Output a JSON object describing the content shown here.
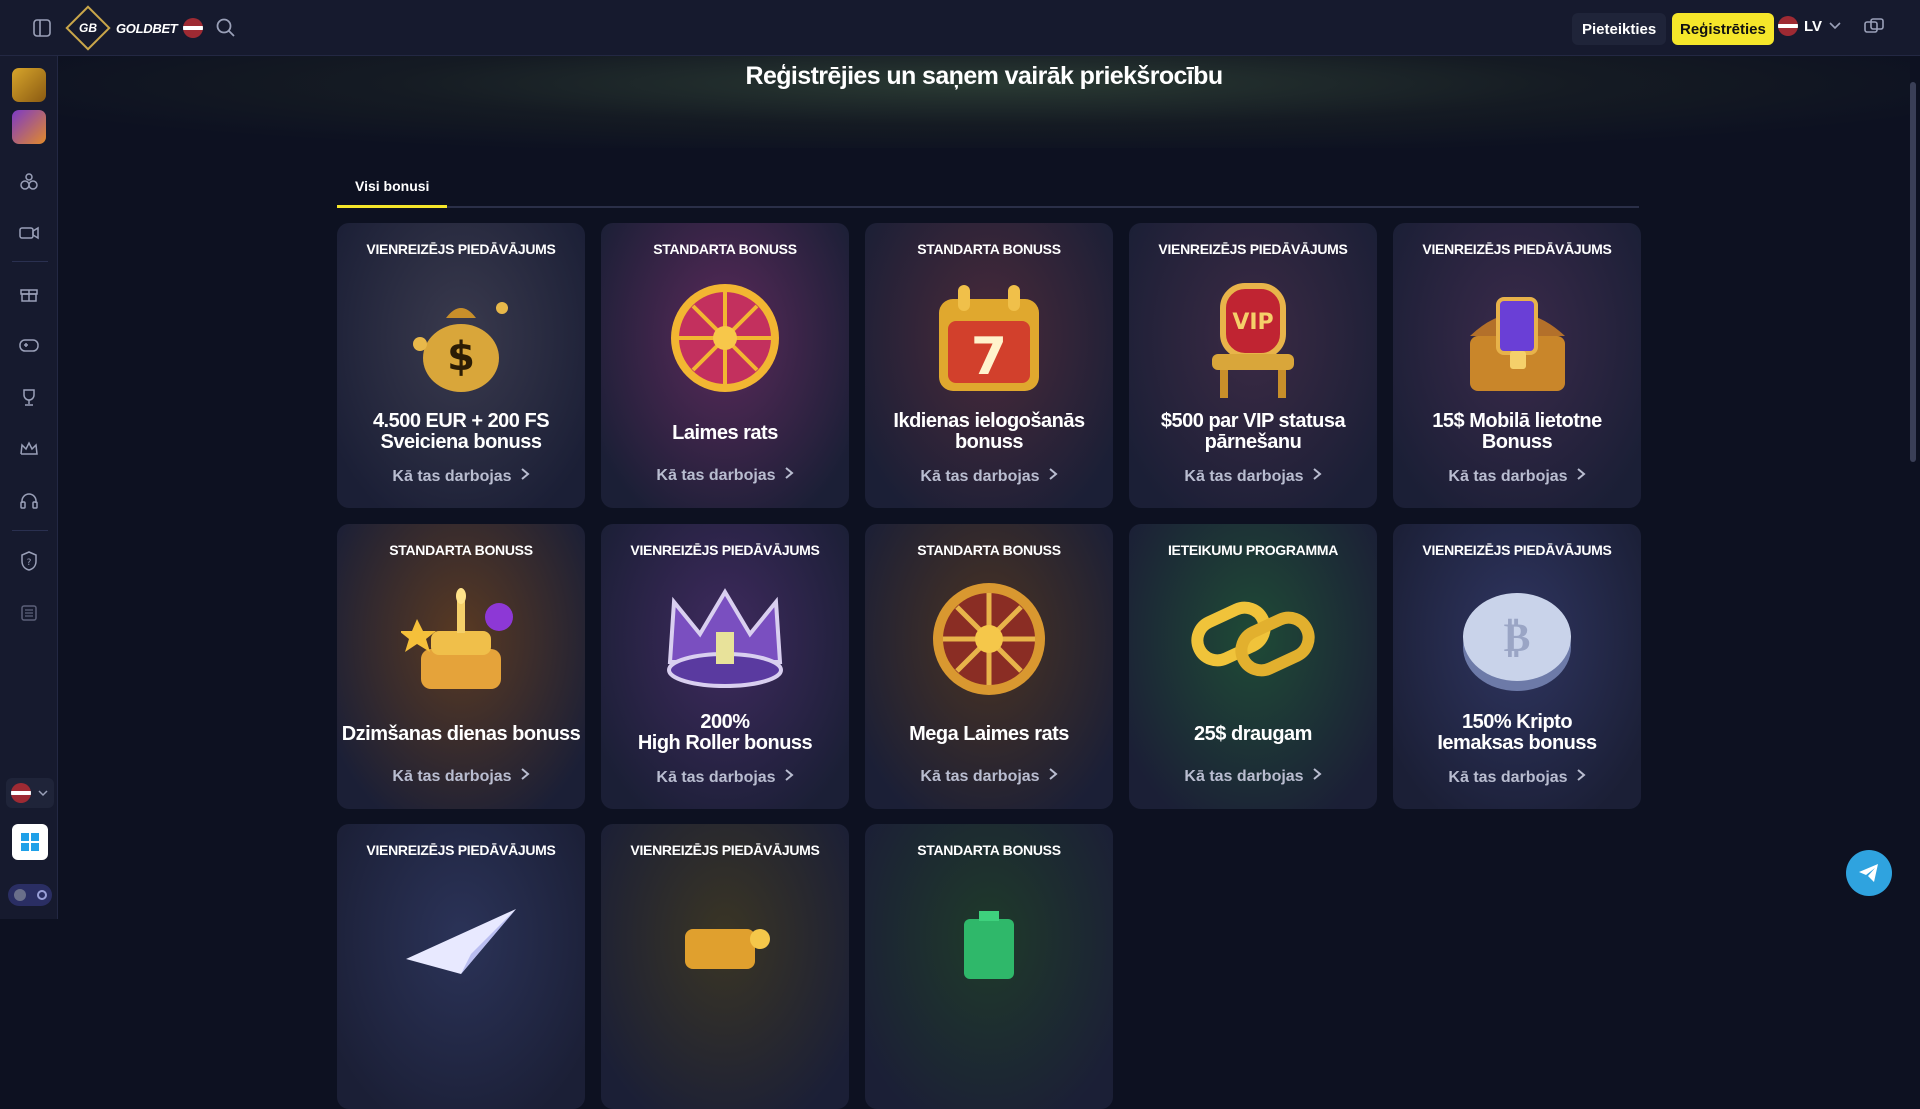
{
  "header": {
    "logo_text": "GOLDBET",
    "logo_mark": "GB",
    "login_label": "Pieteikties",
    "register_label": "Reģistrēties",
    "language_code": "LV"
  },
  "hero": {
    "title": "Reģistrējies un saņem vairāk priekšrocību"
  },
  "tabs": [
    {
      "label": "Visi bonusi",
      "active": true
    }
  ],
  "cards": [
    {
      "label": "VIENREIZĒJS PIEDĀVĀJUMS",
      "title_lines": [
        "4.500 EUR + 200 FS",
        "Sveiciena bonuss"
      ],
      "link": "Kā tas darbojas",
      "art": "money-bag",
      "bg": "#3a3a4d"
    },
    {
      "label": "STANDARTA BONUSS",
      "title_lines": [
        "Laimes rats"
      ],
      "link": "Kā tas darbojas",
      "art": "wheel",
      "bg": "#5a2a5a"
    },
    {
      "label": "STANDARTA BONUSS",
      "title_lines": [
        "Ikdienas ielogošanās",
        "bonuss"
      ],
      "link": "Kā tas darbojas",
      "art": "calendar",
      "bg": "#4a2a3a"
    },
    {
      "label": "VIENREIZĒJS PIEDĀVĀJUMS",
      "title_lines": [
        "$500 par VIP statusa",
        "pārnešanu"
      ],
      "link": "Kā tas darbojas",
      "art": "vip-throne",
      "bg": "#3b2a44"
    },
    {
      "label": "VIENREIZĒJS PIEDĀVĀJUMS",
      "title_lines": [
        "15$ Mobilā lietotne",
        "Bonuss"
      ],
      "link": "Kā tas darbojas",
      "art": "chest",
      "bg": "#3a2a4a"
    },
    {
      "label": "STANDARTA BONUSS",
      "title_lines": [
        "Dzimšanas dienas bonuss"
      ],
      "link": "Kā tas darbojas",
      "art": "cake",
      "bg": "#5a3a22"
    },
    {
      "label": "VIENREIZĒJS PIEDĀVĀJUMS",
      "title_lines": [
        "200%",
        "High Roller bonuss"
      ],
      "link": "Kā tas darbojas",
      "art": "crown",
      "bg": "#3f2a5e"
    },
    {
      "label": "STANDARTA BONUSS",
      "title_lines": [
        "Mega Laimes rats"
      ],
      "link": "Kā tas darbojas",
      "art": "mega-wheel",
      "bg": "#4a3322"
    },
    {
      "label": "IETEIKUMU PROGRAMMA",
      "title_lines": [
        "25$ draugam"
      ],
      "link": "Kā tas darbojas",
      "art": "chain",
      "bg": "#1f4a36"
    },
    {
      "label": "VIENREIZĒJS PIEDĀVĀJUMS",
      "title_lines": [
        "150% Kripto",
        "Iemaksas bonuss"
      ],
      "link": "Kā tas darbojas",
      "art": "crypto-coin",
      "bg": "#2f3560"
    },
    {
      "label": "VIENREIZĒJS PIEDĀVĀJUMS",
      "title_lines": [],
      "link": "",
      "art": "paper-plane",
      "bg": "#2b3358"
    },
    {
      "label": "VIENREIZĒJS PIEDĀVĀJUMS",
      "title_lines": [],
      "link": "",
      "art": "scroll",
      "bg": "#3a3524"
    },
    {
      "label": "STANDARTA BONUSS",
      "title_lines": [],
      "link": "",
      "art": "battery",
      "bg": "#1f3a2a"
    }
  ]
}
